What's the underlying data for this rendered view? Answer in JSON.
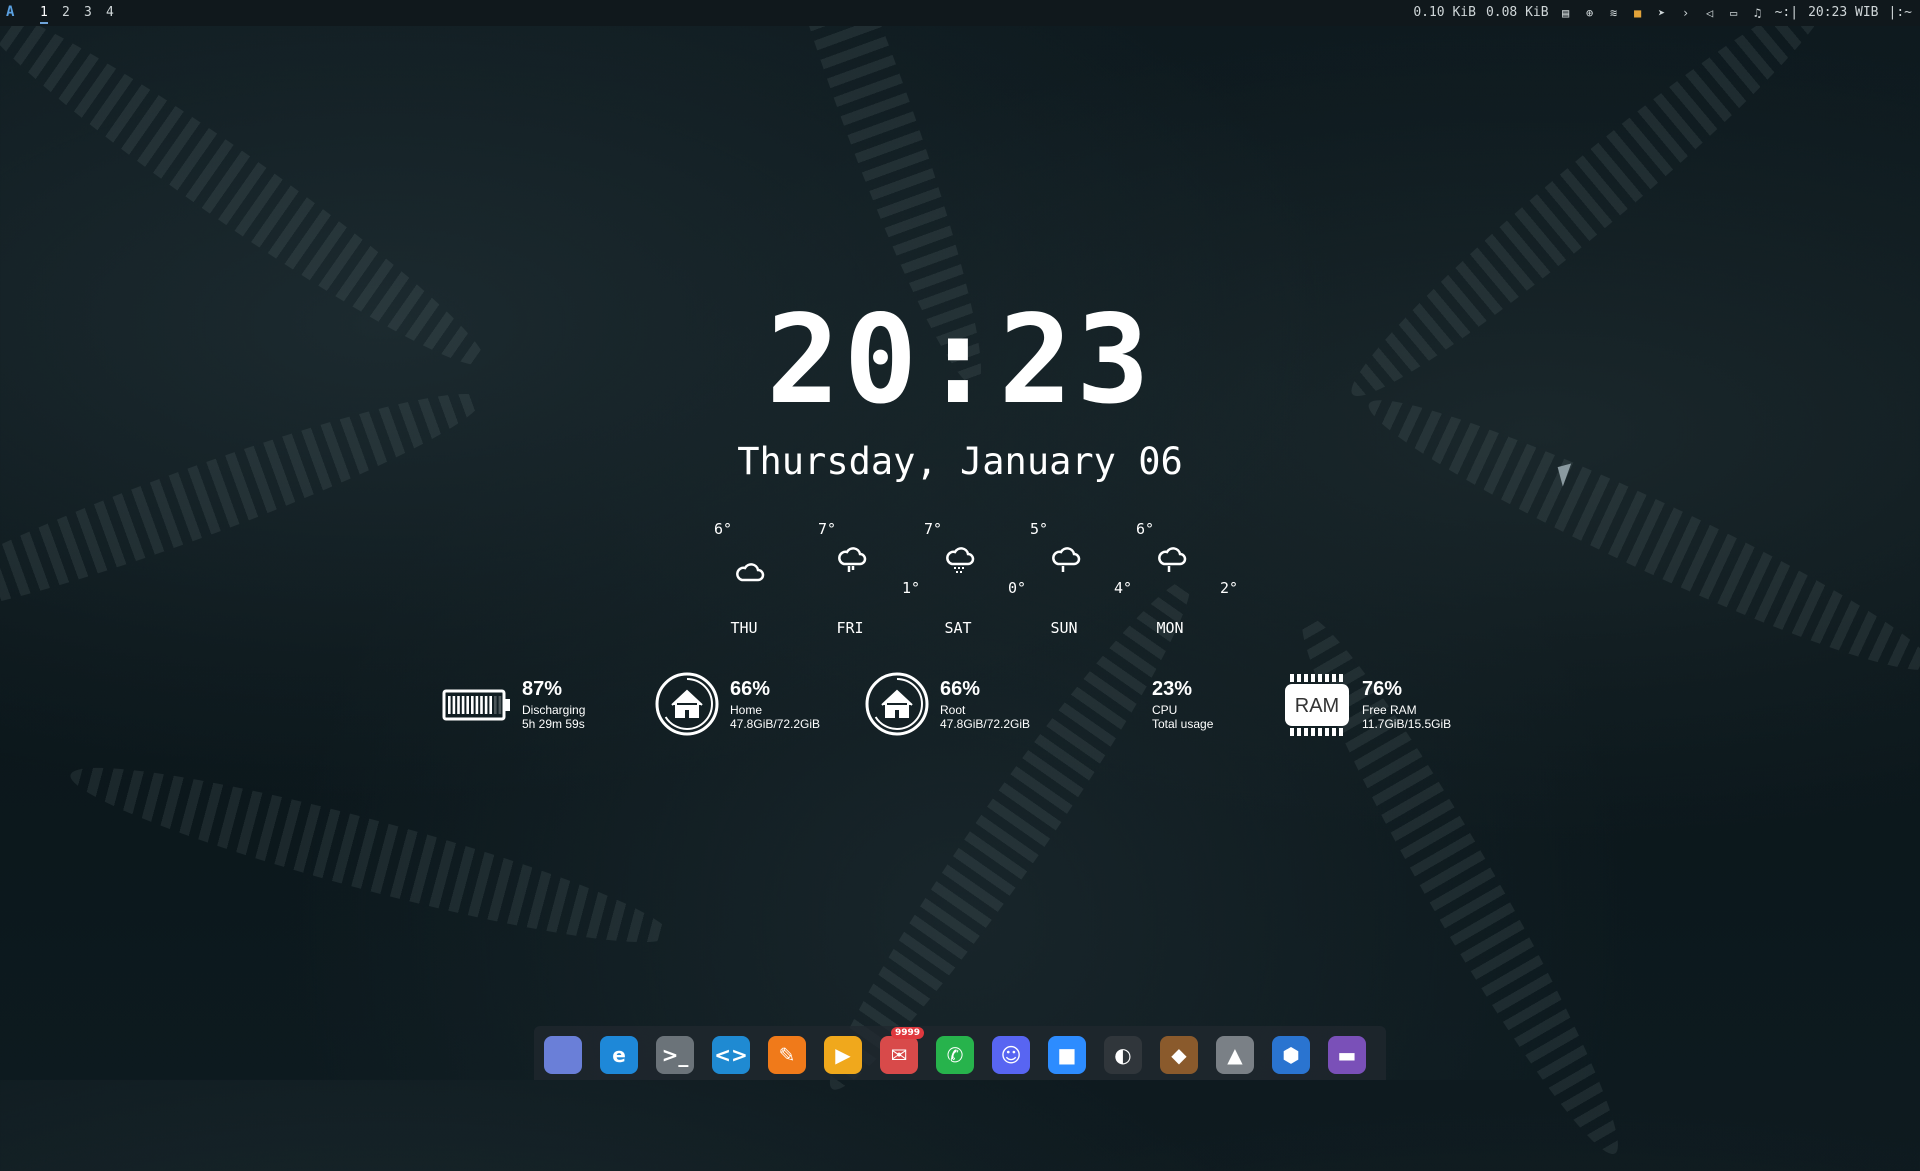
{
  "topbar": {
    "logo": "A",
    "workspaces": [
      "1",
      "2",
      "3",
      "4"
    ],
    "net_down": "0.10 KiB",
    "net_up": "0.08 KiB",
    "terminal_indicator": "~:|",
    "clock": "20:23 WIB",
    "end_marker": "|:~",
    "icons": [
      "clipboard-icon",
      "update-icon",
      "wifi-icon",
      "folder-icon",
      "telegram-icon",
      "expand-icon",
      "volume-icon",
      "battery-icon",
      "bell-icon"
    ]
  },
  "clock": {
    "time": "20:23",
    "date": "Thursday, January 06"
  },
  "weather": [
    {
      "day": "THU",
      "high": "6°",
      "low": "",
      "icon": "cloud-icon"
    },
    {
      "day": "FRI",
      "high": "7°",
      "low": "1°",
      "icon": "rain-cloud-icon"
    },
    {
      "day": "SAT",
      "high": "7°",
      "low": "0°",
      "icon": "drizzle-cloud-icon"
    },
    {
      "day": "SUN",
      "high": "5°",
      "low": "4°",
      "icon": "rain-cloud-icon"
    },
    {
      "day": "MON",
      "high": "6°",
      "low": "2°",
      "icon": "rain-cloud-icon"
    }
  ],
  "stats": {
    "battery": {
      "percent": "87%",
      "label": "Discharging",
      "detail": "5h 29m 59s",
      "level": 0.87
    },
    "home": {
      "percent": "66%",
      "label": "Home",
      "detail": "47.8GiB/72.2GiB"
    },
    "root": {
      "percent": "66%",
      "label": "Root",
      "detail": "47.8GiB/72.2GiB"
    },
    "cpu": {
      "percent": "23%",
      "label": "CPU",
      "detail": "Total usage"
    },
    "ram": {
      "percent": "76%",
      "label": "Free RAM",
      "detail": "11.7GiB/15.5GiB",
      "chip": "RAM"
    }
  },
  "dock": {
    "apps": [
      {
        "name": "files",
        "glyph": "",
        "color": "#6a7fd8"
      },
      {
        "name": "edge",
        "glyph": "e",
        "color": "#1e88d8"
      },
      {
        "name": "terminal",
        "glyph": ">_",
        "color": "#6b7379"
      },
      {
        "name": "vscode",
        "glyph": "<>",
        "color": "#1f8ad2"
      },
      {
        "name": "pencil",
        "glyph": "✎",
        "color": "#f07a1a"
      },
      {
        "name": "presenter",
        "glyph": "▶",
        "color": "#f0a81c"
      },
      {
        "name": "mail",
        "glyph": "✉",
        "color": "#d84a4a",
        "badge": "9999"
      },
      {
        "name": "whatsapp",
        "glyph": "✆",
        "color": "#27b34c"
      },
      {
        "name": "discord",
        "glyph": "☺",
        "color": "#5865f2"
      },
      {
        "name": "zoom",
        "glyph": "■",
        "color": "#2d8cff"
      },
      {
        "name": "obs",
        "glyph": "◐",
        "color": "#30363b"
      },
      {
        "name": "fox",
        "glyph": "◆",
        "color": "#8a5a2c"
      },
      {
        "name": "inkscape",
        "glyph": "▲",
        "color": "#7a8086"
      },
      {
        "name": "virtualbox",
        "glyph": "⬢",
        "color": "#2a74d0"
      },
      {
        "name": "folder",
        "glyph": "▬",
        "color": "#7a50b8"
      }
    ]
  }
}
